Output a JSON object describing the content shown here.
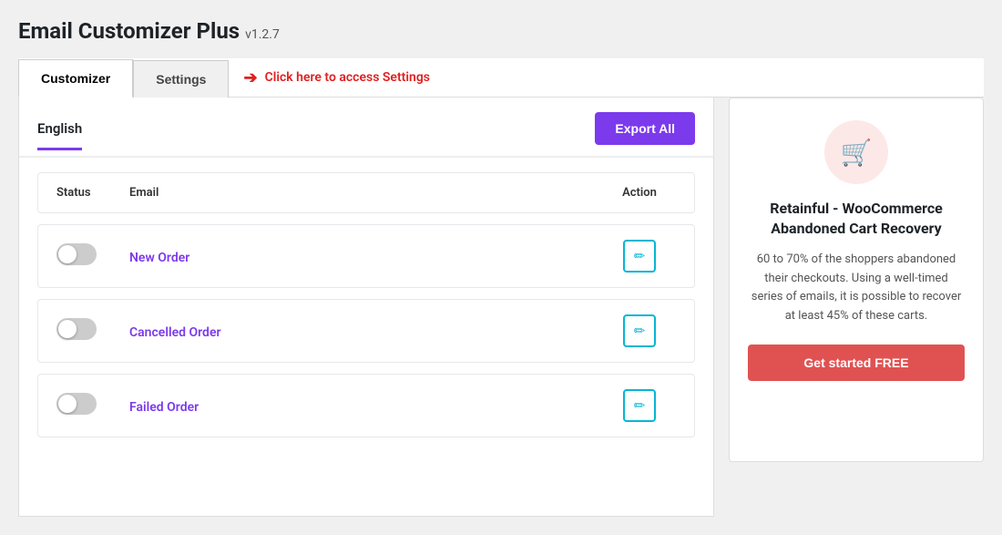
{
  "page": {
    "title": "Email Customizer Plus",
    "version": "v1.2.7"
  },
  "tabs": {
    "customizer_label": "Customizer",
    "settings_label": "Settings",
    "hint_text": "Click here to access Settings"
  },
  "language_tab": {
    "label": "English"
  },
  "toolbar": {
    "export_all_label": "Export All"
  },
  "table": {
    "col_status": "Status",
    "col_email": "Email",
    "col_action": "Action"
  },
  "email_rows": [
    {
      "id": 1,
      "name": "New Order",
      "enabled": false
    },
    {
      "id": 2,
      "name": "Cancelled Order",
      "enabled": false
    },
    {
      "id": 3,
      "name": "Failed Order",
      "enabled": false
    }
  ],
  "promo": {
    "title": "Retainful - WooCommerce Abandoned Cart Recovery",
    "description": "60 to 70% of the shoppers abandoned their checkouts. Using a well-timed series of emails, it is possible to recover at least 45% of these carts.",
    "cta_label": "Get started FREE",
    "icon": "🛒"
  }
}
